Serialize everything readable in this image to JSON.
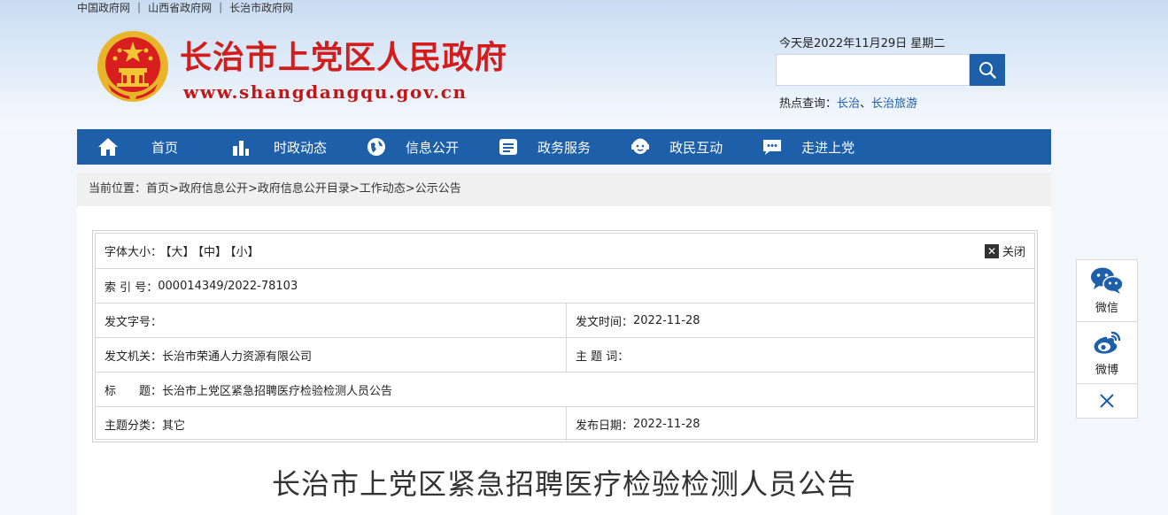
{
  "top_links": [
    "中国政府网",
    "山西省政府网",
    "长治市政府网"
  ],
  "site": {
    "title": "长治市上党区人民政府",
    "url": "www.shangdangqu.gov.cn"
  },
  "date_text": "今天是2022年11月29日 星期二",
  "search": {
    "placeholder": ""
  },
  "hot": {
    "label": "热点查询：",
    "items": [
      "长治",
      "长治旅游"
    ],
    "sep": "、"
  },
  "nav": [
    {
      "label": "首页",
      "icon": "home-icon"
    },
    {
      "label": "时政动态",
      "icon": "bar-chart-icon"
    },
    {
      "label": "信息公开",
      "icon": "globe-icon"
    },
    {
      "label": "政务服务",
      "icon": "document-icon"
    },
    {
      "label": "政民互动",
      "icon": "person-icon"
    },
    {
      "label": "走进上党",
      "icon": "chat-icon"
    }
  ],
  "breadcrumb": {
    "label": "当前位置：",
    "items": [
      "首页",
      "政府信息公开",
      "政府信息公开目录",
      "工作动态",
      "公示公告"
    ],
    "sep": ">"
  },
  "meta": {
    "font_size_label": "字体大小：",
    "font_size_options": [
      "【大】",
      "【中】",
      "【小】"
    ],
    "close_label": "关闭",
    "index_label": "索 引 号：",
    "index_value": "000014349/2022-78103",
    "doc_no_label": "发文字号：",
    "doc_no_value": "",
    "issue_time_label": "发文时间：",
    "issue_time_value": "2022-11-28",
    "issuer_label": "发文机关：",
    "issuer_value": "长治市荣通人力资源有限公司",
    "subject_label": "主 题 词：",
    "subject_value": "",
    "title_label": "标　　题：",
    "title_value": "长治市上党区紧急招聘医疗检验检测人员公告",
    "category_label": "主题分类：",
    "category_value": "其它",
    "publish_date_label": "发布日期：",
    "publish_date_value": "2022-11-28"
  },
  "article_title": "长治市上党区紧急招聘医疗检验检测人员公告",
  "share": {
    "wechat": "微信",
    "weibo": "微博"
  },
  "colors": {
    "brand_blue": "#1d5fa8",
    "title_red": "#d21d1d"
  }
}
